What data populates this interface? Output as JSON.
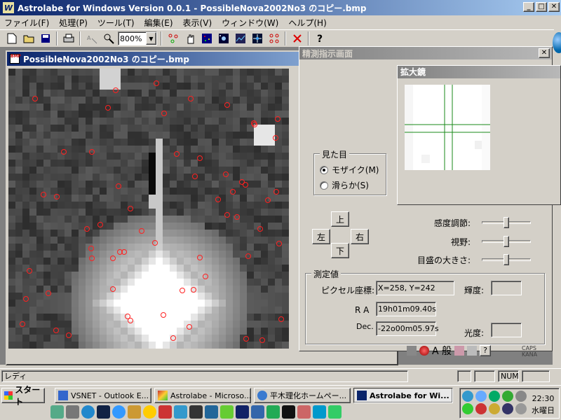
{
  "app": {
    "title": "Astrolabe for Windows Version 0.0.1 - PossibleNova2002No3 のコピー.bmp",
    "controls": {
      "minimize": "_",
      "maximize": "□",
      "close": "✕"
    }
  },
  "menu": [
    "ファイル(F)",
    "処理(P)",
    "ツール(T)",
    "編集(E)",
    "表示(V)",
    "ウィンドウ(W)",
    "ヘルプ(H)"
  ],
  "toolbar": {
    "zoom_value": "800%",
    "icons": [
      "new-file-icon",
      "open-folder-icon",
      "save-icon",
      "print-icon",
      "measure-icon",
      "zoom-tool-icon"
    ],
    "icons2": [
      "marker-icon",
      "hand-icon",
      "grid-icon",
      "star-detect-icon",
      "image-process-icon",
      "crosshair-icon",
      "circles-icon",
      "delete-icon",
      "help-icon"
    ]
  },
  "image_window": {
    "title": "PossibleNova2002No3 のコピー.bmp"
  },
  "observation_panel": {
    "title": "精測指示画面",
    "appearance_group": "見た目",
    "radio_mosaic": "モザイク(M)",
    "radio_smooth": "滑らか(S)",
    "mosaic_selected": true,
    "up": "上",
    "left": "左",
    "right": "右",
    "down": "下",
    "sensitivity_label": "感度調節:",
    "fov_label": "視野:",
    "scale_label": "目盛の大きさ:",
    "measure_group": "測定値",
    "pixel_label": "ピクセル座標:",
    "pixel_value": "X=258, Y=242",
    "ra_label": "R A",
    "ra_value": "19h01m09.40s",
    "dec_label": "Dec.",
    "dec_value": "-22o00m05.97s",
    "brightness_label": "輝度:",
    "brightness_value": "",
    "magnitude_label": "光度:",
    "magnitude_value": ""
  },
  "magnifier": {
    "title": "拡大鏡"
  },
  "status_bar": {
    "text": "レディ",
    "num": "NUM"
  },
  "ime": {
    "caps": "CAPS",
    "kana": "KANA",
    "mode": "A 般"
  },
  "taskbar": {
    "start": "スタート",
    "tasks": [
      {
        "label": "VSNET - Outlook E...",
        "active": false
      },
      {
        "label": "Astrolabe - Microso...",
        "active": false
      },
      {
        "label": "平木理化ホームペー...",
        "active": false
      },
      {
        "label": "Astrolabe for Wi...",
        "active": true
      }
    ],
    "clock_time": "22:30",
    "clock_day": "水曜日"
  }
}
